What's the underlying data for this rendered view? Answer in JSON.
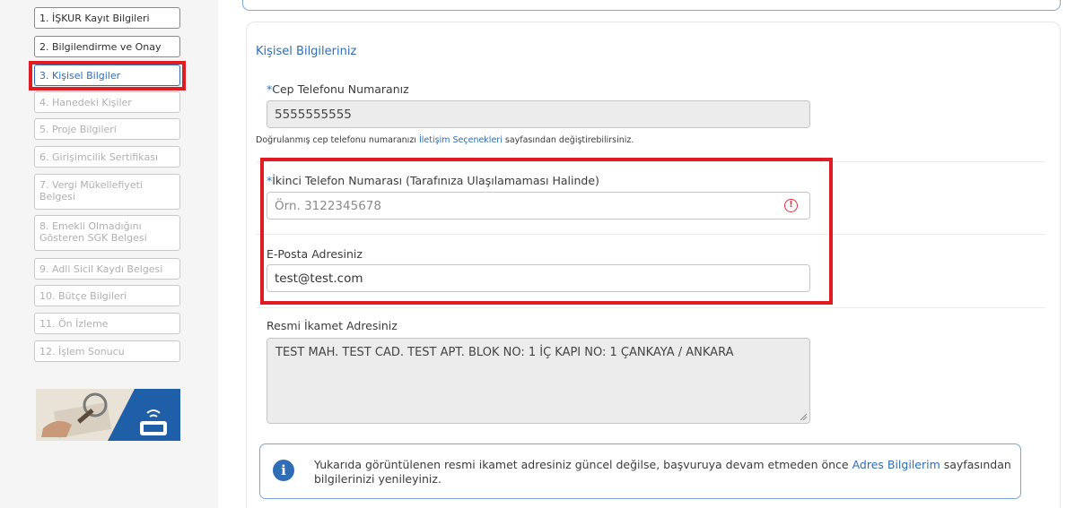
{
  "sidebar": {
    "steps": [
      {
        "label": "1. İŞKUR Kayıt Bilgileri"
      },
      {
        "label": "2. Bilgilendirme ve Onay"
      },
      {
        "label": "3. Kişisel Bilgiler"
      },
      {
        "label": "4. Hanedeki Kişiler"
      },
      {
        "label": "5. Proje Bilgileri"
      },
      {
        "label": "6. Girişimcilik Sertifikası"
      },
      {
        "label": "7. Vergi Mükellefiyeti Belgesi"
      },
      {
        "label": "8. Emekli Olmadığını Gösteren SGK Belgesi"
      },
      {
        "label": "9. Adli Sicil Kaydı Belgesi"
      },
      {
        "label": "10. Bütçe Bilgileri"
      },
      {
        "label": "11. Ön İzleme"
      },
      {
        "label": "12. İşlem Sonucu"
      }
    ]
  },
  "form": {
    "section_title": "Kişisel Bilgileriniz",
    "required_mark": "*",
    "phone": {
      "label": "Cep Telefonu Numaranız",
      "value": "5555555555"
    },
    "helper": {
      "before": "Doğrulanmış cep telefonu numaranızı ",
      "link": "İletişim Seçenekleri",
      "after": " sayfasından değiştirebilirsiniz."
    },
    "second_phone": {
      "label": "İkinci Telefon Numarası (Tarafınıza Ulaşılamaması Halinde)",
      "placeholder": "Örn. 3122345678",
      "warn_glyph": "!"
    },
    "email": {
      "label": "E-Posta Adresiniz",
      "value": "test@test.com"
    },
    "address": {
      "label": "Resmi İkamet Adresiniz",
      "value": "TEST MAH. TEST CAD. TEST APT. BLOK  NO: 1  İÇ KAPI NO: 1 ÇANKAYA / ANKARA"
    },
    "info": {
      "icon_glyph": "i",
      "before": "Yukarıda görüntülenen resmi ikamet adresiniz güncel değilse, başvuruya devam etmeden önce ",
      "link": "Adres Bilgilerim",
      "after": " sayfasından bilgilerinizi yenileyiniz."
    }
  },
  "colors": {
    "accent": "#2f6db5",
    "highlight": "#e01b24",
    "warning": "#e0333a"
  }
}
